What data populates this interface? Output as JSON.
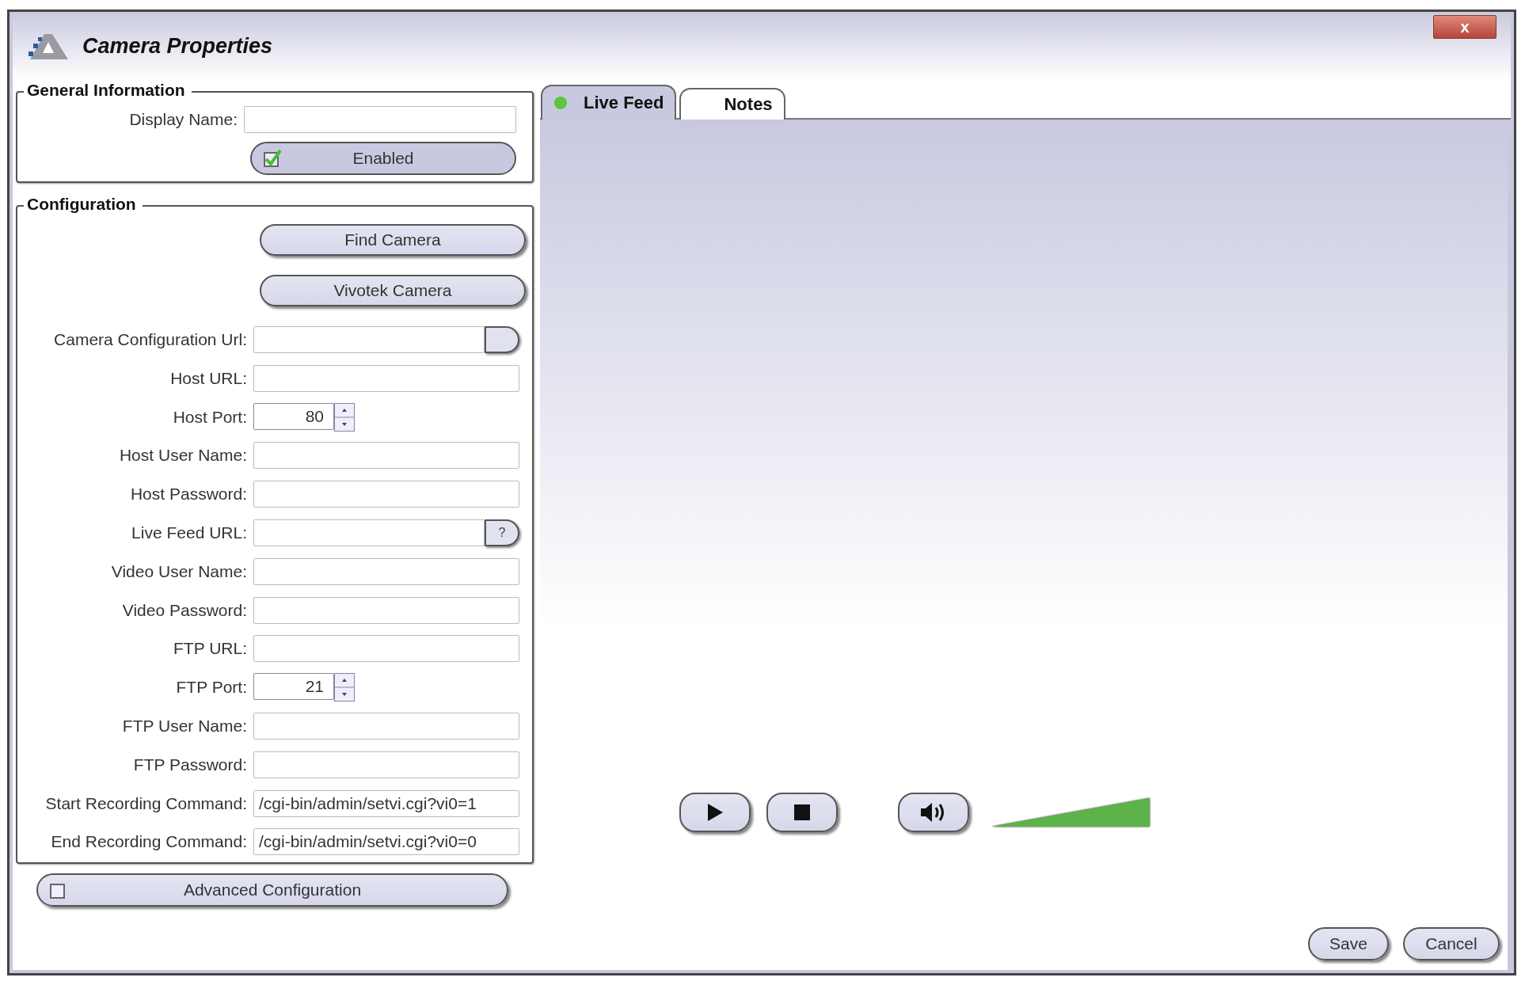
{
  "window": {
    "title": "Camera Properties",
    "close_button": "x"
  },
  "general_information": {
    "title": "General Information",
    "display_name_label": "Display Name:",
    "enabled": {
      "label": "Enabled",
      "checked": true
    }
  },
  "configuration": {
    "title": "Configuration",
    "buttons": [
      "Find Camera",
      "Vivotek Camera"
    ],
    "fields": [
      {
        "kind": "browse",
        "label": "Camera Configuration Url:"
      },
      {
        "kind": "text",
        "label": "Host URL:"
      },
      {
        "kind": "spinner",
        "label": "Host Port:",
        "value": "80"
      },
      {
        "kind": "text",
        "label": "Host User Name:"
      },
      {
        "kind": "text",
        "label": "Host Password:"
      },
      {
        "kind": "browse",
        "label": "Live Feed URL:",
        "button": "?"
      },
      {
        "kind": "text",
        "label": "Video User Name:"
      },
      {
        "kind": "text",
        "label": "Video Password:"
      },
      {
        "kind": "text",
        "label": "FTP URL:"
      },
      {
        "kind": "spinner",
        "label": "FTP Port:",
        "value": "21"
      },
      {
        "kind": "text",
        "label": "FTP User Name:"
      },
      {
        "kind": "text",
        "label": "FTP Password:"
      },
      {
        "kind": "text",
        "label": "Start Recording Command:",
        "value": "/cgi-bin/admin/setvi.cgi?vi0=1"
      },
      {
        "kind": "text",
        "label": "End Recording Command:",
        "value": "/cgi-bin/admin/setvi.cgi?vi0=0"
      }
    ]
  },
  "advanced_configuration": {
    "label": "Advanced Configuration",
    "checked": false
  },
  "tabs": [
    {
      "label": "Live Feed",
      "selected": true,
      "live": true
    },
    {
      "label": "Notes",
      "selected": false,
      "live": false
    }
  ],
  "player": {
    "volume": {
      "level": 1
    }
  },
  "buttons": [
    "Save",
    "Cancel"
  ]
}
